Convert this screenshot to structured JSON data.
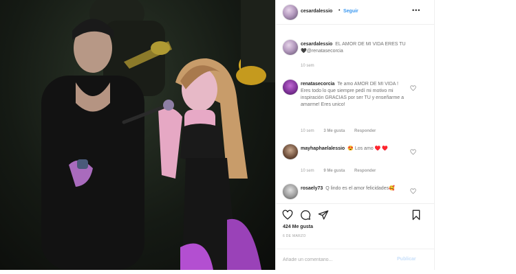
{
  "post": {
    "username": "cesardalessio",
    "follow_label": "Seguir",
    "header_separator": "•",
    "more_label": "•••"
  },
  "caption": {
    "username": "cesardalessio",
    "text": "EL AMOR DE MI VIDA ERES TU 🖤@renatasecorcia",
    "time": "10 sem"
  },
  "comments": [
    {
      "username": "renatasecorcia",
      "text": "Te amo AMOR DE MI VIDA ! Eres todo lo que siempre pedí mi motivo mi inspiración GRACIAS por ser TU y enseñarme a amarme! Eres unico!",
      "time": "10 sem",
      "likes": "3 Me gusta",
      "reply": "Responder"
    },
    {
      "username": "mayhaphaelalessio",
      "text": "😍 Los amo ♥️ ♥️",
      "time": "10 sem",
      "likes": "9 Me gusta",
      "reply": "Responder"
    },
    {
      "username": "rosaely73",
      "text": "Q lindo es el amor felicidades🥰",
      "time": "",
      "likes": "",
      "reply": ""
    }
  ],
  "actions": {
    "likes_count": "424 Me gusta",
    "date": "6 DE MARZO"
  },
  "add_comment": {
    "placeholder": "Añade un comentario...",
    "publish_label": "Publicar"
  },
  "colors": {
    "link_blue": "#3897f0",
    "publish_disabled": "#c7dffa",
    "stage_purple": "#b34fd1",
    "background_dark": "#151a14"
  },
  "icons": [
    "heart-icon",
    "comment-icon",
    "share-icon",
    "bookmark-icon",
    "more-options-icon"
  ]
}
